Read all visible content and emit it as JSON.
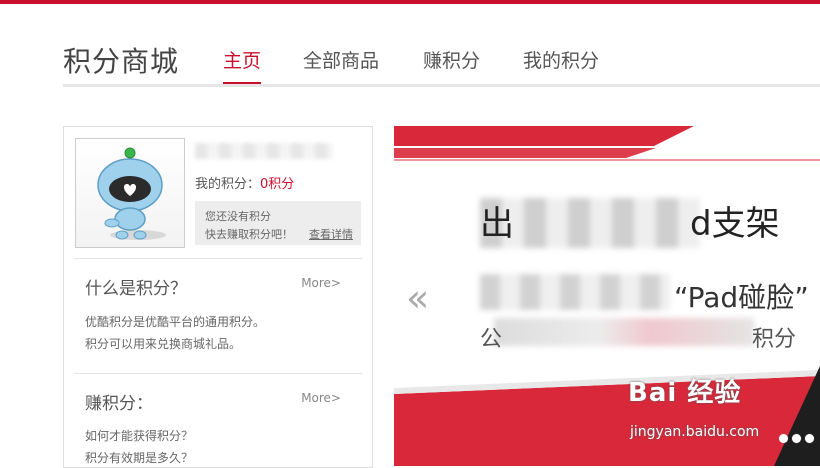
{
  "header": {
    "site_title": "积分商城",
    "nav": [
      {
        "label": "主页",
        "active": true
      },
      {
        "label": "全部商品",
        "active": false
      },
      {
        "label": "赚积分",
        "active": false
      },
      {
        "label": "我的积分",
        "active": false
      }
    ]
  },
  "sidebar": {
    "avatar_icon": "robot-avatar-icon",
    "points_label": "我的积分：",
    "points_value": "0积分",
    "notice_line1": "您还没有积分",
    "notice_line2": "快去赚取积分吧！",
    "notice_link": "查看详情",
    "sections": [
      {
        "title": "什么是积分？",
        "more": "More>",
        "lines": [
          "优酷积分是优酷平台的通用积分。",
          "积分可以用来兑换商城礼品。"
        ]
      },
      {
        "title": "赚积分：",
        "more": "More>",
        "lines": [
          "如何才能获得积分？",
          "积分有效期是多久？"
        ]
      }
    ]
  },
  "banner": {
    "prev_icon": "«",
    "line1": "出",
    "line1_tail": "d支架",
    "line2": "“Pad碰脸”",
    "line3_prefix": "公",
    "line3_suffix": "积分"
  },
  "watermark": {
    "logo": "Bai 经验",
    "url": "jingyan.baidu.com"
  },
  "colors": {
    "accent": "#c8102e",
    "banner_red": "#d9283a"
  }
}
